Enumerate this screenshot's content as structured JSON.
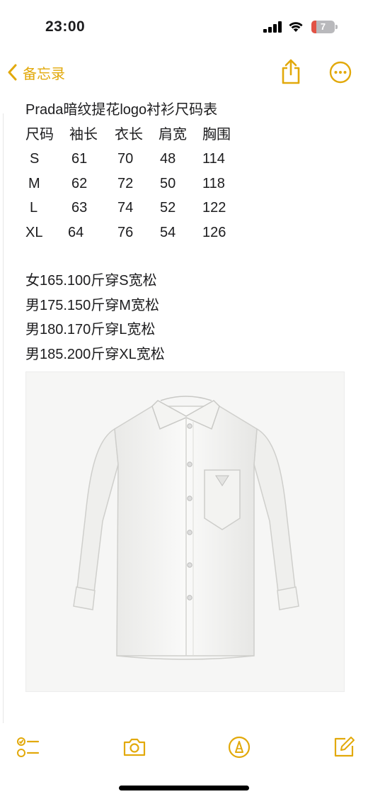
{
  "status_bar": {
    "time": "23:00",
    "battery_level": "7",
    "battery_fraction": 0.07
  },
  "nav": {
    "back_label": "备忘录",
    "accent_color": "#E2A90B",
    "icons": [
      "chevron-left-icon",
      "share-icon",
      "more-icon"
    ]
  },
  "note": {
    "title": "Prada暗纹提花logo衬衫尺码表",
    "table": {
      "headers": [
        "尺码",
        "袖长",
        "衣长",
        "肩宽",
        "胸围"
      ],
      "rows": [
        [
          "S",
          "61",
          "70",
          "48",
          "114"
        ],
        [
          "M",
          "62",
          "72",
          "50",
          "118"
        ],
        [
          "L",
          "63",
          "74",
          "52",
          "122"
        ],
        [
          "XL",
          "64",
          "76",
          "54",
          "126"
        ]
      ]
    },
    "recommendations": [
      "女165.100斤穿S宽松",
      "男175.150斤穿M宽松",
      "男180.170斤穿L宽松",
      "男185.200斤穿XL宽松"
    ]
  },
  "toolbar": {
    "icons": [
      "checklist-icon",
      "camera-icon",
      "markup-pen-icon",
      "compose-icon"
    ]
  }
}
